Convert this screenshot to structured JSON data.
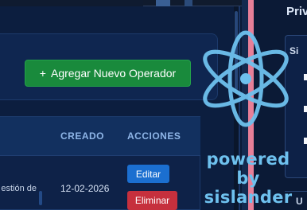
{
  "toolbar": {
    "add_button_icon": "+",
    "add_button_label": "Agregar Nuevo Operador"
  },
  "table": {
    "columns": [
      "CREADO",
      "ACCIONES"
    ],
    "rows": [
      {
        "description_fragment": "estión de",
        "created": "12-02-2026",
        "edit_label": "Editar",
        "delete_label": "Eliminar"
      }
    ]
  },
  "side_panel": {
    "title": "Priv",
    "section_label": "Si",
    "bottom_label": "U"
  },
  "watermark": {
    "logo_icon": "atom-icon",
    "line1": "powered by",
    "line2": "sislander"
  },
  "colors": {
    "background": "#0b1a36",
    "primary_button": "#198a3c",
    "edit_button": "#1b6fd0",
    "delete_button": "#c6303d",
    "header_text": "#8fb6e8",
    "accent_strip": "#e77f98",
    "watermark": "#6ec1ee"
  }
}
